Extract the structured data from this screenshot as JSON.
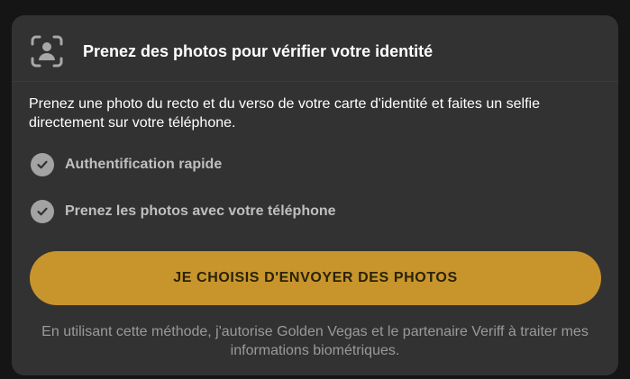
{
  "card": {
    "title": "Prenez des photos pour vérifier votre identité",
    "description": "Prenez une photo du recto et du verso de votre carte d'identité et faites un selfie directement sur votre téléphone.",
    "features": [
      {
        "label": "Authentification rapide",
        "icon": "check-circle-icon"
      },
      {
        "label": "Prenez les photos avec votre téléphone",
        "icon": "check-circle-icon"
      }
    ],
    "cta_label": "JE CHOISIS D'ENVOYER DES PHOTOS",
    "consent": "En utilisant cette méthode, j'autorise Golden Vegas et le partenaire Veriff à traiter mes informations biométriques.",
    "header_icon": "face-scan-icon"
  },
  "colors": {
    "background": "#151515",
    "card": "#323232",
    "accent": "#c8952c",
    "check": "#a3a3a3"
  }
}
